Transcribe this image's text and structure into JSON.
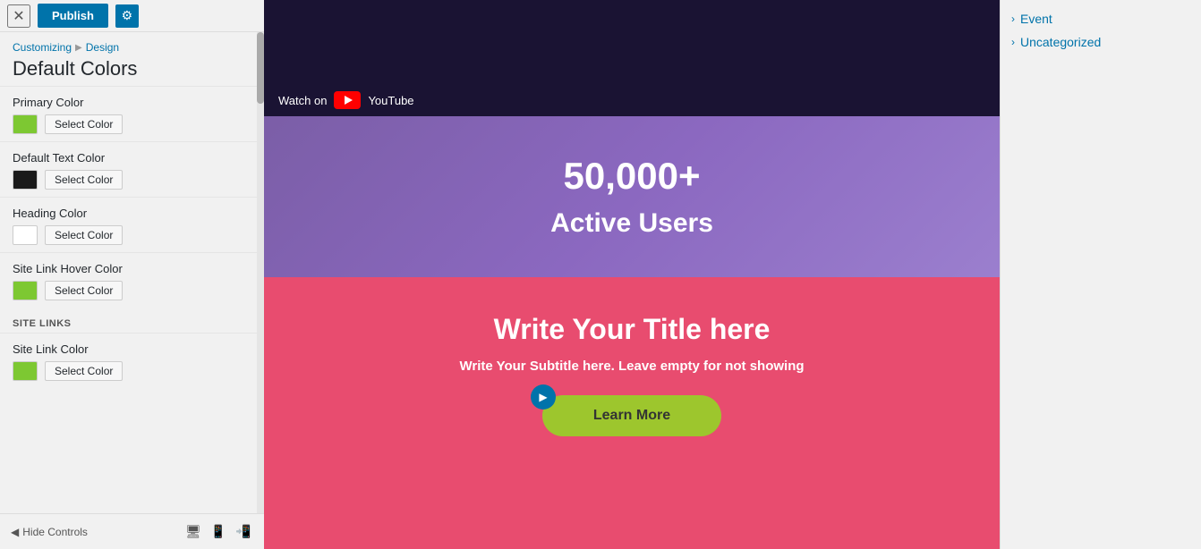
{
  "topbar": {
    "close_label": "✕",
    "publish_label": "Publish",
    "gear_label": "⚙"
  },
  "breadcrumb": {
    "customizing": "Customizing",
    "separator": "▶",
    "design": "Design"
  },
  "page_title": "Default Colors",
  "colors": [
    {
      "id": "primary",
      "label": "Primary Color",
      "swatch": "#7dc832",
      "button": "Select Color"
    },
    {
      "id": "default-text",
      "label": "Default Text Color",
      "swatch": "#1a1a1a",
      "button": "Select Color"
    },
    {
      "id": "heading",
      "label": "Heading Color",
      "swatch": "#ffffff",
      "button": "Select Color"
    },
    {
      "id": "site-link-hover",
      "label": "Site Link Hover Color",
      "swatch": "#7dc832",
      "button": "Select Color"
    }
  ],
  "site_links": {
    "heading": "SITE LINKS",
    "color_label": "Site Link Color",
    "color_swatch": "#7dc832",
    "color_button": "Select Color"
  },
  "bottombar": {
    "back_label": "Hide Controls",
    "back_icon": "◀"
  },
  "main": {
    "video": {
      "watch_on": "Watch on",
      "youtube": "YouTube"
    },
    "stats": {
      "number": "50,000+",
      "label": "Active Users"
    },
    "cta": {
      "title": "Write Your Title here",
      "subtitle": "Write Your Subtitle here. Leave empty for not showing",
      "button": "Learn More"
    }
  },
  "right_panel": {
    "items": [
      {
        "label": "Event"
      },
      {
        "label": "Uncategorized"
      }
    ]
  }
}
